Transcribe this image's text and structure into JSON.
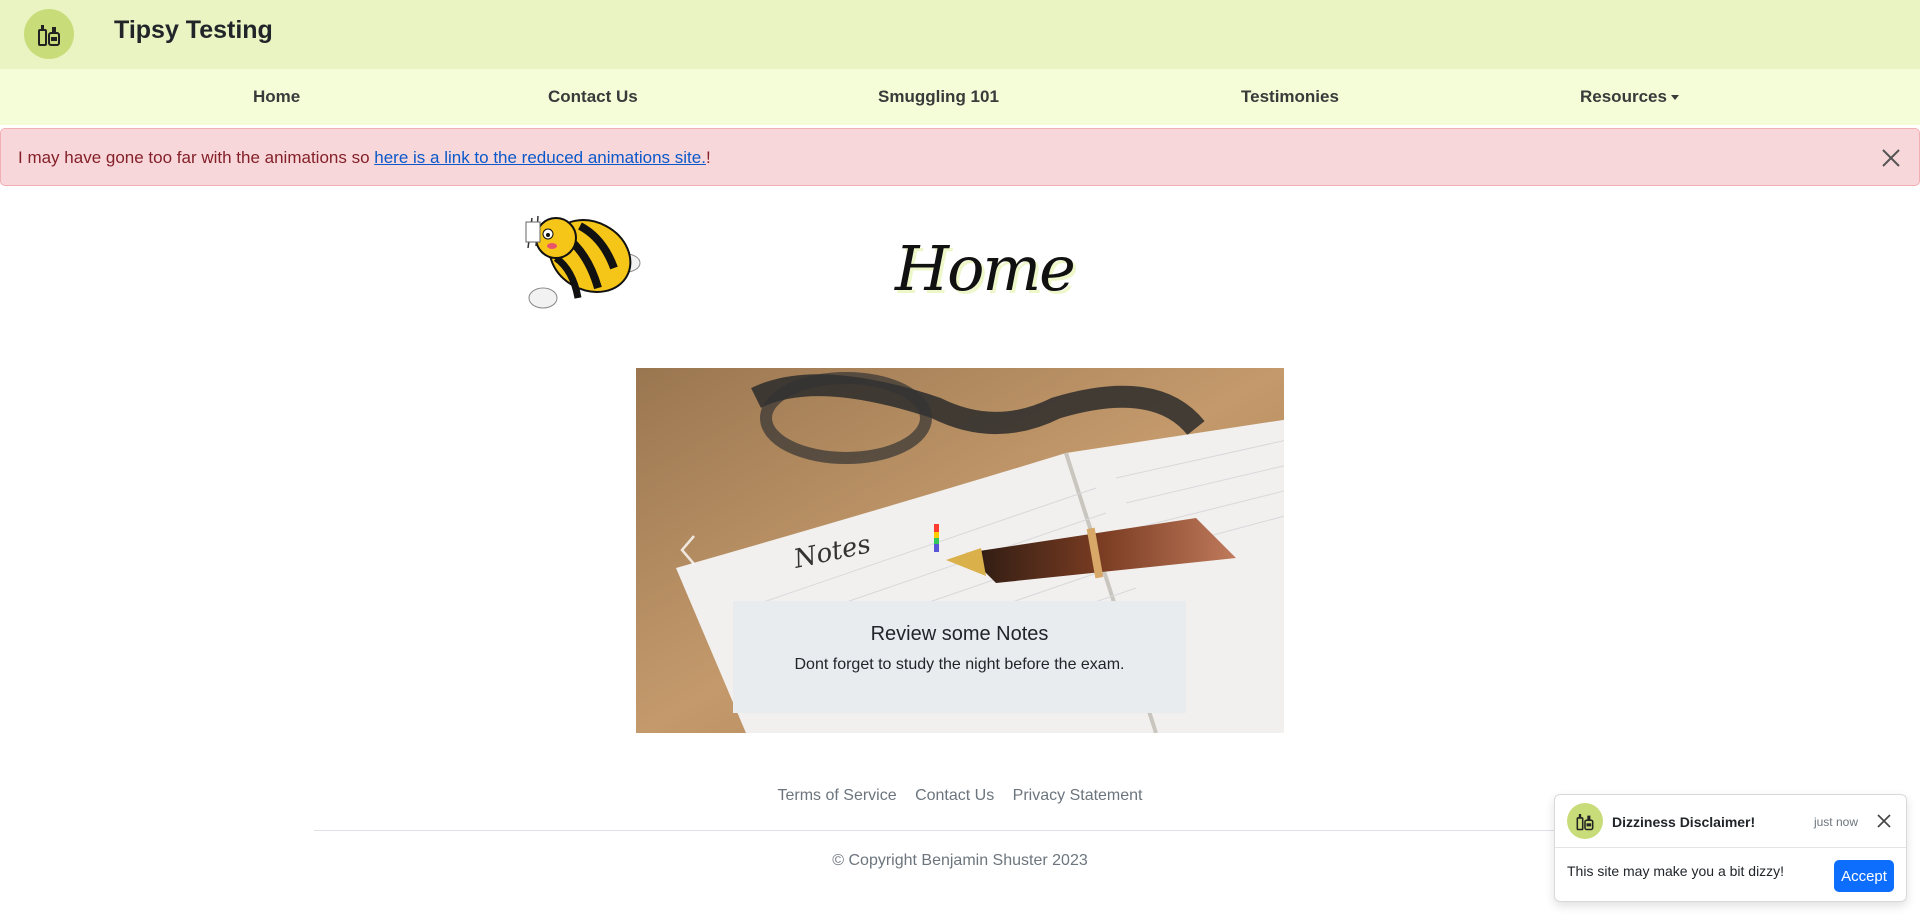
{
  "brand": {
    "title": "Tipsy Testing",
    "logo_icon": "bottles-icon",
    "logo_color": "#c9dc7a"
  },
  "nav": {
    "items": [
      {
        "label": "Home"
      },
      {
        "label": "Contact Us"
      },
      {
        "label": "Smuggling 101"
      },
      {
        "label": "Testimonies"
      },
      {
        "label": "Resources",
        "has_dropdown": true
      }
    ]
  },
  "alert": {
    "prefix": "I may have gone too far with the animations so ",
    "link_text": "here is a link to the reduced animations site.",
    "suffix": "!",
    "close_icon": "close-icon"
  },
  "header": {
    "page_title": "Home",
    "mascot_icon": "bee-icon"
  },
  "carousel": {
    "slide_title": "Review some Notes",
    "slide_text": "Dont forget to study the night before the exam.",
    "notebook_word": "Notes",
    "prev_icon": "chevron-left-icon"
  },
  "footer": {
    "links": [
      "Terms of Service",
      "Contact Us",
      "Privacy Statement"
    ],
    "copyright": "© Copyright Benjamin Shuster 2023"
  },
  "toast": {
    "title": "Dizziness Disclaimer!",
    "time": "just now",
    "body": "This site may make you a bit dizzy!",
    "accept_label": "Accept"
  },
  "colors": {
    "brandbar": "#e9f4c2",
    "navbar": "#f5fcd8",
    "alert_bg": "#f8d7da",
    "alert_text": "#842029",
    "link": "#0a58ca",
    "primary": "#0d6efd"
  }
}
